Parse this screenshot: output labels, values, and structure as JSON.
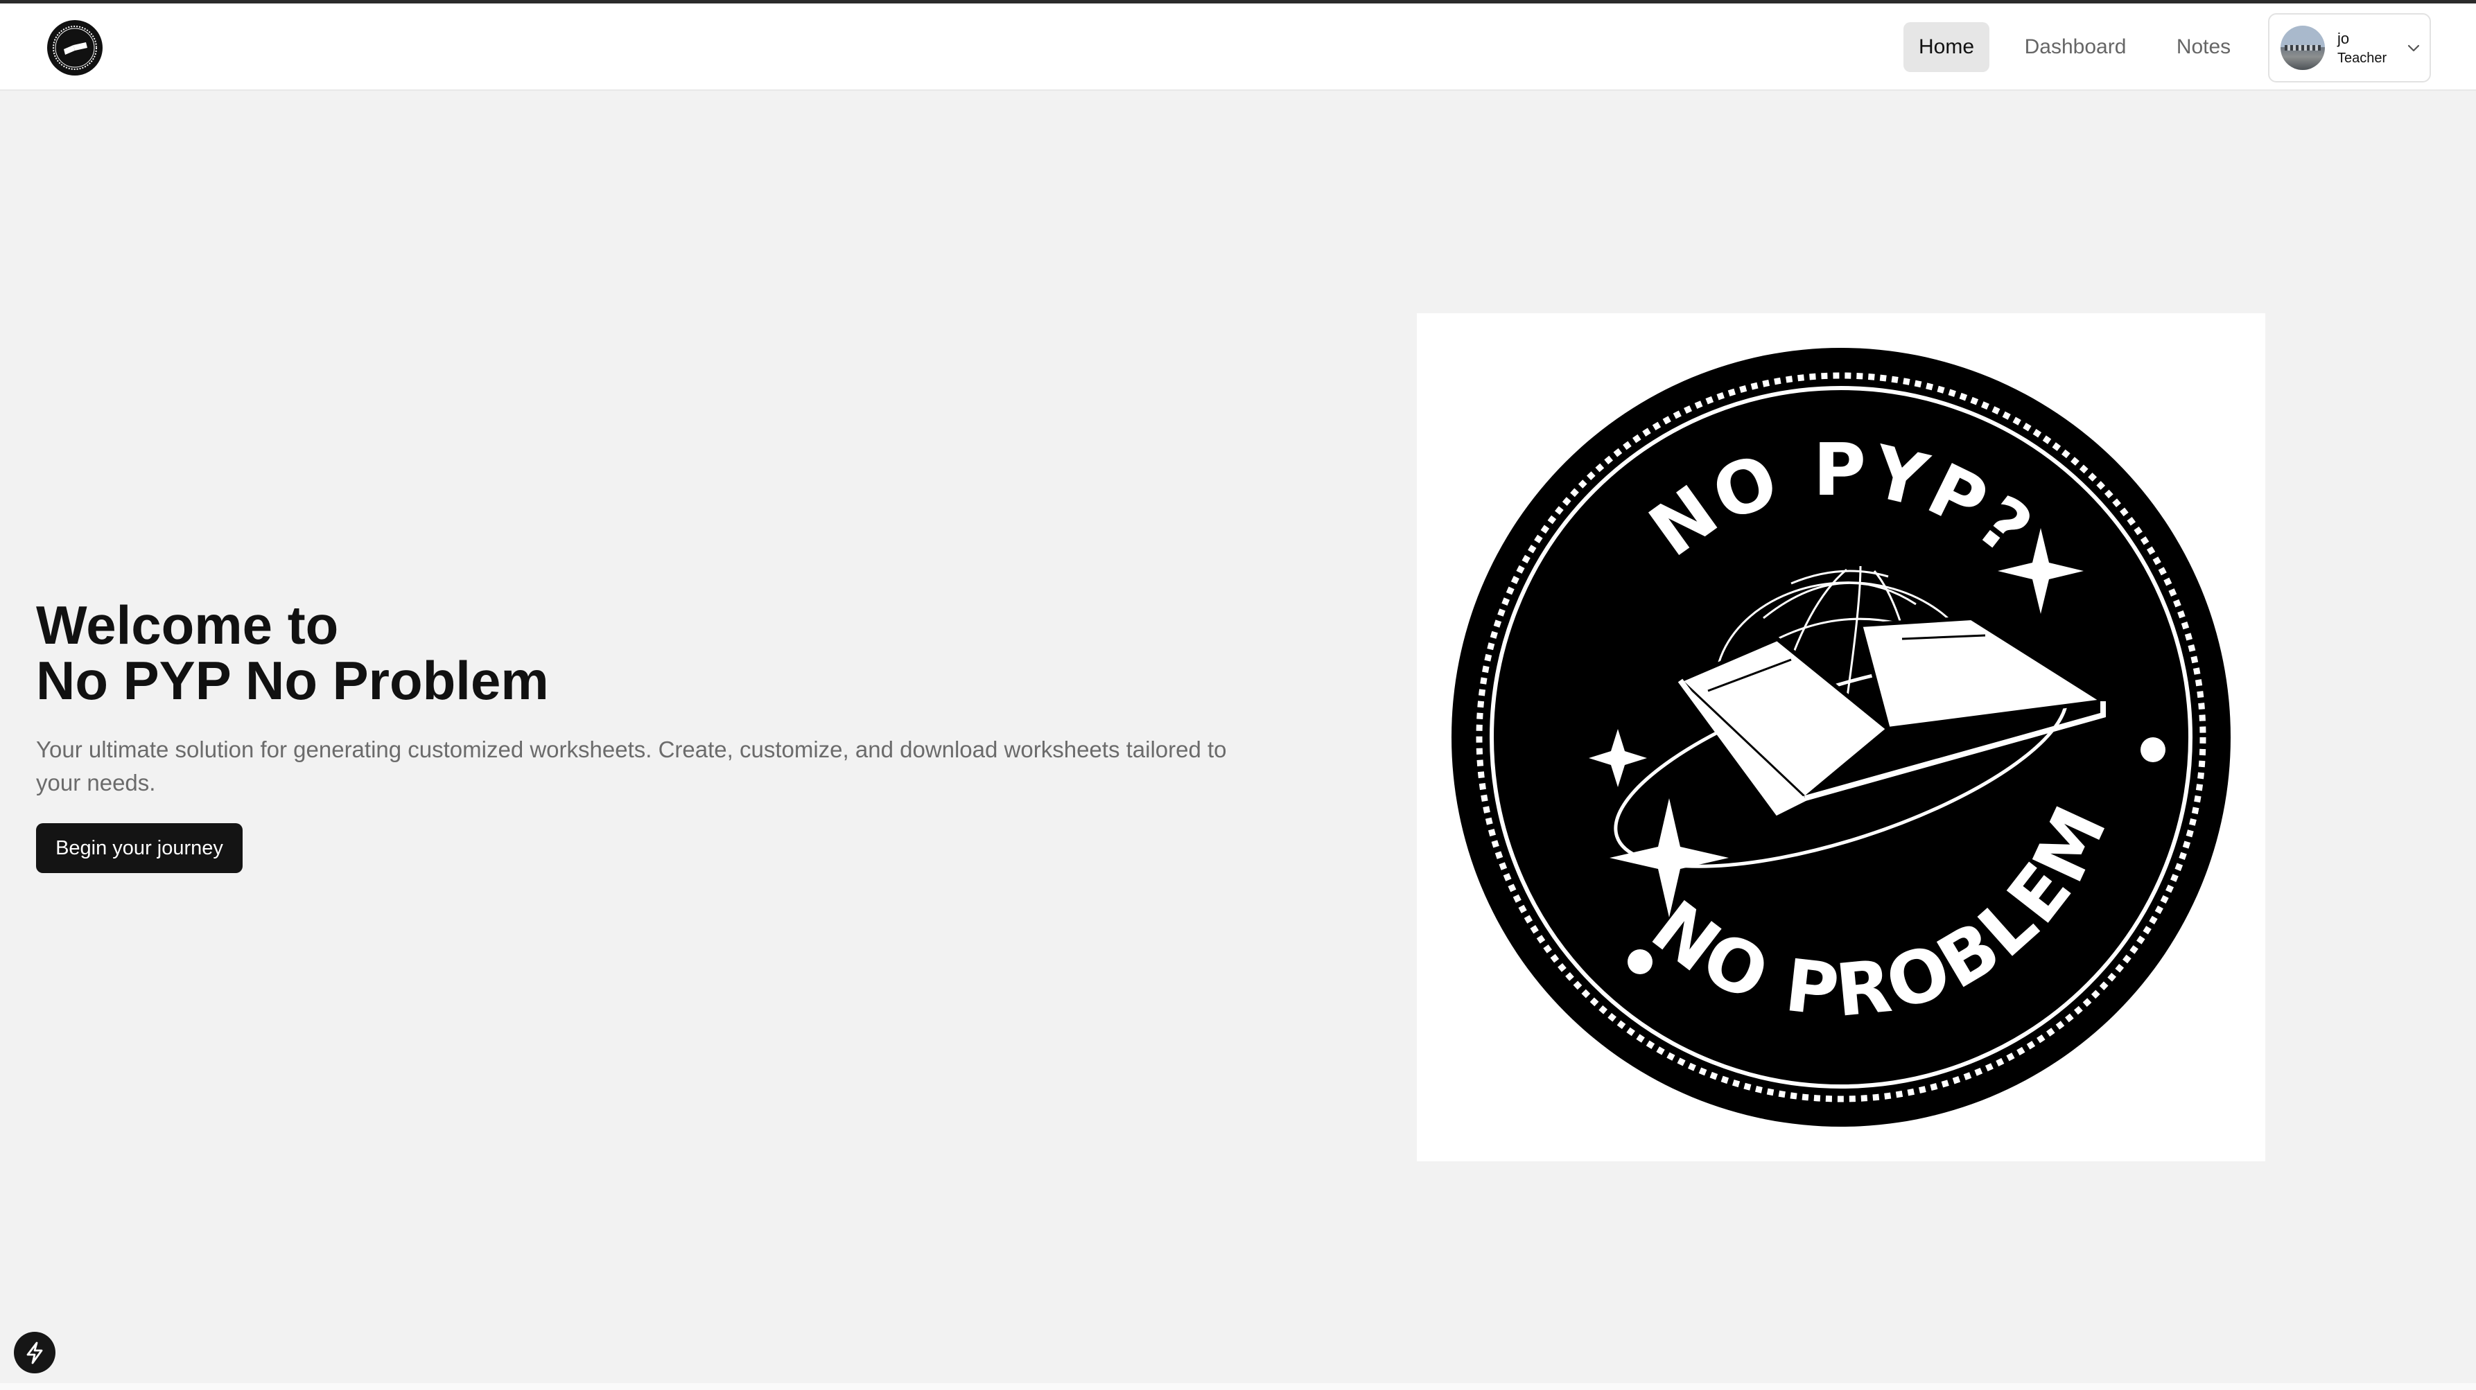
{
  "nav": {
    "logo_icon": "no-pyp-badge-icon",
    "links": [
      {
        "label": "Home",
        "active": true
      },
      {
        "label": "Dashboard",
        "active": false
      },
      {
        "label": "Notes",
        "active": false
      }
    ],
    "user": {
      "name": "jo",
      "role": "Teacher",
      "menu_icon": "chevron-down-icon"
    }
  },
  "hero": {
    "title_line1": "Welcome to",
    "title_line2": "No PYP No Problem",
    "description": "Your ultimate solution for generating customized worksheets. Create, customize, and download worksheets tailored to your needs.",
    "cta_label": "Begin your journey"
  },
  "logo": {
    "top_text": "NO PYP?",
    "bottom_text": "NO PROBLEM",
    "icon": "open-book-globe-icon"
  },
  "floating_button_icon": "lightning-bolt-icon",
  "colors": {
    "accent": "#141414",
    "background": "#f2f2f2",
    "navbar": "#ffffff"
  }
}
